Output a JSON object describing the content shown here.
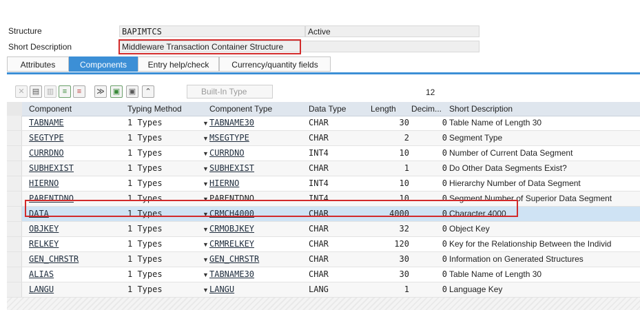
{
  "header": {
    "structure_label": "Structure",
    "structure_value": "BAPIMTCS",
    "status": "Active",
    "short_desc_label": "Short Description",
    "short_desc_value": "Middleware Transaction Container Structure"
  },
  "tabs": [
    {
      "label": "Attributes",
      "active": false
    },
    {
      "label": "Components",
      "active": true
    },
    {
      "label": "Entry help/check",
      "active": false
    },
    {
      "label": "Currency/quantity fields",
      "active": false
    }
  ],
  "toolbar": {
    "icons": [
      "cut-icon",
      "copy-icon",
      "paste-icon",
      "insert-row-icon",
      "delete-row-icon",
      "collapse-icon",
      "expand-all-icon",
      "select-all-icon",
      "move-up-icon"
    ],
    "builtin_label": "Built-In Type",
    "count": "12"
  },
  "columns": {
    "component": "Component",
    "typing_method": "Typing Method",
    "component_type": "Component Type",
    "data_type": "Data Type",
    "length": "Length",
    "decimals": "Decim...",
    "short_description": "Short Description"
  },
  "rows": [
    {
      "component": "TABNAME",
      "typing": "1 Types",
      "ctype": "TABNAME30",
      "dtype": "CHAR",
      "length": "30",
      "dec": "0",
      "desc": "Table Name of Length 30",
      "ctype_link": true
    },
    {
      "component": "SEGTYPE",
      "typing": "1 Types",
      "ctype": "MSEGTYPE",
      "dtype": "CHAR",
      "length": "2",
      "dec": "0",
      "desc": "Segment Type",
      "ctype_link": true
    },
    {
      "component": "CURRDNO",
      "typing": "1 Types",
      "ctype": "CURRDNO",
      "dtype": "INT4",
      "length": "10",
      "dec": "0",
      "desc": "Number of Current Data Segment",
      "ctype_link": true
    },
    {
      "component": "SUBHEXIST",
      "typing": "1 Types",
      "ctype": "SUBHEXIST",
      "dtype": "CHAR",
      "length": "1",
      "dec": "0",
      "desc": "Do Other Data Segments Exist?",
      "ctype_link": true
    },
    {
      "component": "HIERNO",
      "typing": "1 Types",
      "ctype": "HIERNO",
      "dtype": "INT4",
      "length": "10",
      "dec": "0",
      "desc": "Hierarchy Number of Data Segment",
      "ctype_link": true
    },
    {
      "component": "PARENTDNO",
      "typing": "1 Types",
      "ctype": "PARENTDNO",
      "dtype": "INT4",
      "length": "10",
      "dec": "0",
      "desc": "Segment Number of Superior Data Segment",
      "ctype_link": false
    },
    {
      "component": "DATA",
      "typing": "1 Types",
      "ctype": "CRMCH4000",
      "dtype": "CHAR",
      "length": "4000",
      "dec": "0",
      "desc": "Character 4000",
      "ctype_link": true,
      "selected": true
    },
    {
      "component": "OBJKEY",
      "typing": "1 Types",
      "ctype": "CRMOBJKEY",
      "dtype": "CHAR",
      "length": "32",
      "dec": "0",
      "desc": "Object Key",
      "ctype_link": true
    },
    {
      "component": "RELKEY",
      "typing": "1 Types",
      "ctype": "CRMRELKEY",
      "dtype": "CHAR",
      "length": "120",
      "dec": "0",
      "desc": "Key for the Relationship Between the Individ",
      "ctype_link": true
    },
    {
      "component": "GEN_CHRSTR",
      "typing": "1 Types",
      "ctype": "GEN_CHRSTR",
      "dtype": "CHAR",
      "length": "30",
      "dec": "0",
      "desc": "Information on Generated Structures",
      "ctype_link": true
    },
    {
      "component": "ALIAS",
      "typing": "1 Types",
      "ctype": "TABNAME30",
      "dtype": "CHAR",
      "length": "30",
      "dec": "0",
      "desc": "Table Name of Length 30",
      "ctype_link": true
    },
    {
      "component": "LANGU",
      "typing": "1 Types",
      "ctype": "LANGU",
      "dtype": "LANG",
      "length": "1",
      "dec": "0",
      "desc": "Language Key",
      "ctype_link": true
    }
  ],
  "colors": {
    "accent": "#3c8fd6",
    "highlight": "#d22a2a",
    "selected_row": "#cfe3f4",
    "header_bg": "#dfe6ee"
  }
}
